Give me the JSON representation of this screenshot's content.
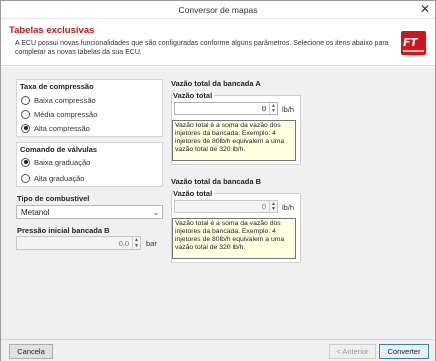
{
  "window": {
    "title": "Conversor de mapas",
    "close_glyph": "✕"
  },
  "header": {
    "title": "Tabelas exclusivas",
    "description": "A ECU possui novas funcionalidades que são configuradas conforme alguns parâmetros. Selecione os itens abaixo para completar as novas tabelas da sua ECU.",
    "logo_text": "FT",
    "logo_color": "#d4141b"
  },
  "left": {
    "compression": {
      "title": "Taxa de compressão",
      "options": [
        "Baixa compressão",
        "Média compressão",
        "Alta compressão"
      ],
      "selected": 2
    },
    "valves": {
      "title": "Comando de válvulas",
      "options": [
        "Baixa graduação",
        "Alta graduação"
      ],
      "selected": 0
    },
    "fuel": {
      "title": "Tipo de combustível",
      "value": "Metanol"
    },
    "pressure": {
      "title": "Pressão inicial bancada B",
      "value": "0,0",
      "unit": "bar"
    }
  },
  "right": {
    "bank_a": {
      "title": "Vazão total da bancada A",
      "legend": "Vazão total",
      "value": "0",
      "unit": "lb/h",
      "tooltip": "Vazão total é a soma da vazão dos injetores da bancada. Exemplo: 4 injetores de 80lb/h equivalem a uma vazão total de 320 lb/h."
    },
    "bank_b": {
      "title": "Vazão total da bancada B",
      "legend": "Vazão total",
      "value": "0",
      "unit": "lb/h",
      "tooltip": "Vazão total é a soma da vazão dos injetores da bancada. Exemplo: 4 injetores de 80lb/h equivalem a uma vazão total de 320 lb/h."
    }
  },
  "footer": {
    "cancel": "Cancela",
    "previous": "< Anterior",
    "convert": "Converter"
  }
}
